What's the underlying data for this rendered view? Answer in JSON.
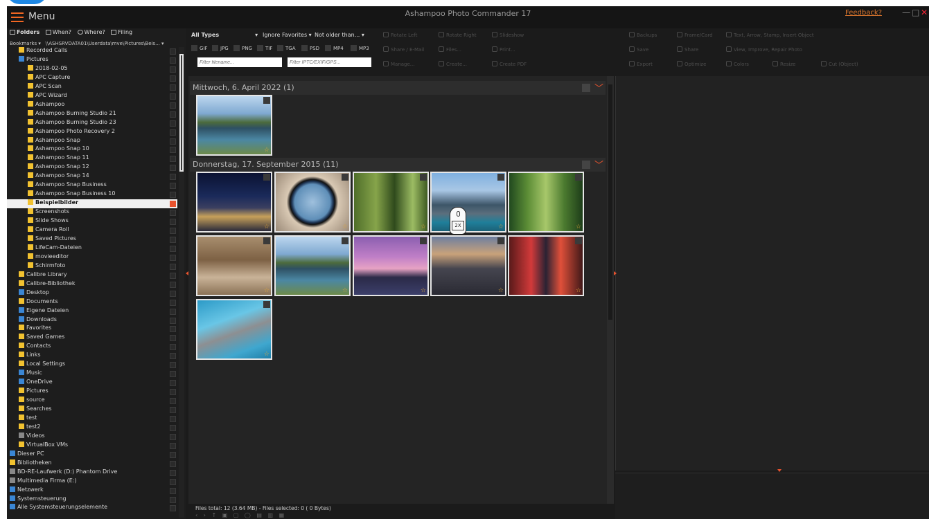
{
  "window": {
    "menu_label": "Menu",
    "title": "Ashampoo Photo Commander 17",
    "feedback_link": "Feedback?",
    "minimize": "—",
    "maximize": "□",
    "close": "✕"
  },
  "view_tabs": [
    {
      "label": "Folders"
    },
    {
      "label": "When?"
    },
    {
      "label": "Where?"
    },
    {
      "label": "Filing"
    }
  ],
  "bookmarks": {
    "label": "Bookmarks",
    "path": "\\\\ASHSRVDATA01\\Userdata\\mve\\Pictures\\Beis..."
  },
  "folder_tree": [
    {
      "label": "Recorded Calls",
      "indent": 2,
      "color": "yellow"
    },
    {
      "label": "Pictures",
      "indent": 2,
      "color": "blue"
    },
    {
      "label": "2018-02-05",
      "indent": 3,
      "color": "yellow"
    },
    {
      "label": "APC Capture",
      "indent": 3,
      "color": "yellow"
    },
    {
      "label": "APC Scan",
      "indent": 3,
      "color": "yellow"
    },
    {
      "label": "APC Wizard",
      "indent": 3,
      "color": "yellow"
    },
    {
      "label": "Ashampoo",
      "indent": 3,
      "color": "yellow"
    },
    {
      "label": "Ashampoo Burning Studio 21",
      "indent": 3,
      "color": "yellow"
    },
    {
      "label": "Ashampoo Burning Studio 23",
      "indent": 3,
      "color": "yellow"
    },
    {
      "label": "Ashampoo Photo Recovery 2",
      "indent": 3,
      "color": "yellow"
    },
    {
      "label": "Ashampoo Snap",
      "indent": 3,
      "color": "yellow"
    },
    {
      "label": "Ashampoo Snap 10",
      "indent": 3,
      "color": "yellow"
    },
    {
      "label": "Ashampoo Snap 11",
      "indent": 3,
      "color": "yellow"
    },
    {
      "label": "Ashampoo Snap 12",
      "indent": 3,
      "color": "yellow"
    },
    {
      "label": "Ashampoo Snap 14",
      "indent": 3,
      "color": "yellow"
    },
    {
      "label": "Ashampoo Snap Business",
      "indent": 3,
      "color": "yellow"
    },
    {
      "label": "Ashampoo Snap Business 10",
      "indent": 3,
      "color": "yellow"
    },
    {
      "label": "Beispielbilder",
      "indent": 3,
      "color": "yellow",
      "selected": true
    },
    {
      "label": "Screenshots",
      "indent": 3,
      "color": "yellow"
    },
    {
      "label": "Slide Shows",
      "indent": 3,
      "color": "yellow"
    },
    {
      "label": "Camera Roll",
      "indent": 3,
      "color": "yellow"
    },
    {
      "label": "Saved Pictures",
      "indent": 3,
      "color": "yellow"
    },
    {
      "label": "LifeCam-Dateien",
      "indent": 3,
      "color": "yellow"
    },
    {
      "label": "movieeditor",
      "indent": 3,
      "color": "yellow"
    },
    {
      "label": "Schirmfoto",
      "indent": 3,
      "color": "yellow"
    },
    {
      "label": "Calibre Library",
      "indent": 2,
      "color": "yellow"
    },
    {
      "label": "Calibre-Bibliothek",
      "indent": 2,
      "color": "yellow"
    },
    {
      "label": "Desktop",
      "indent": 2,
      "color": "blue"
    },
    {
      "label": "Documents",
      "indent": 2,
      "color": "yellow"
    },
    {
      "label": "Eigene Dateien",
      "indent": 2,
      "color": "blue"
    },
    {
      "label": "Downloads",
      "indent": 2,
      "color": "blue"
    },
    {
      "label": "Favorites",
      "indent": 2,
      "color": "yellow"
    },
    {
      "label": "Saved Games",
      "indent": 2,
      "color": "yellow"
    },
    {
      "label": "Contacts",
      "indent": 2,
      "color": "yellow"
    },
    {
      "label": "Links",
      "indent": 2,
      "color": "yellow"
    },
    {
      "label": "Local Settings",
      "indent": 2,
      "color": "yellow"
    },
    {
      "label": "Music",
      "indent": 2,
      "color": "blue"
    },
    {
      "label": "OneDrive",
      "indent": 2,
      "color": "blue"
    },
    {
      "label": "Pictures",
      "indent": 2,
      "color": "yellow"
    },
    {
      "label": "source",
      "indent": 2,
      "color": "yellow"
    },
    {
      "label": "Searches",
      "indent": 2,
      "color": "yellow"
    },
    {
      "label": "test",
      "indent": 2,
      "color": "yellow"
    },
    {
      "label": "test2",
      "indent": 2,
      "color": "yellow"
    },
    {
      "label": "Videos",
      "indent": 2,
      "color": "gray"
    },
    {
      "label": "VirtualBox VMs",
      "indent": 2,
      "color": "yellow"
    },
    {
      "label": "Dieser PC",
      "indent": 1,
      "color": "blue"
    },
    {
      "label": "Bibliotheken",
      "indent": 1,
      "color": "yellow"
    },
    {
      "label": "BD-RE-Laufwerk (D:) Phantom Drive",
      "indent": 1,
      "color": "gray"
    },
    {
      "label": "Multimedia Firma (E:)",
      "indent": 1,
      "color": "gray"
    },
    {
      "label": "Netzwerk",
      "indent": 1,
      "color": "blue"
    },
    {
      "label": "Systemsteuerung",
      "indent": 1,
      "color": "blue"
    },
    {
      "label": "Alle Systemsteuerungselemente",
      "indent": 1,
      "color": "blue"
    }
  ],
  "filters": {
    "type": "All Types",
    "favorites": "Ignore Favorites",
    "age": "Not older than...",
    "file_types": [
      "GIF",
      "JPG",
      "PNG",
      "TIF",
      "TGA",
      "PSD",
      "MP4",
      "MP3"
    ],
    "filename_placeholder": "Filter filename...",
    "exif_placeholder": "Filter IPTC/EXIF/GPS..."
  },
  "toolbar": [
    [
      "Rotate Left",
      "Rotate Right",
      "Slideshow",
      "Backups",
      "Frame/Card",
      "Text, Arrow, Stamp, Insert Object"
    ],
    [
      "Share / E-Mail",
      "Files...",
      "Print...",
      "Save",
      "Share",
      "View, Improve, Repair Photo"
    ],
    [
      "Manage...",
      "Create...",
      "Create PDF",
      "Export",
      "Optimize",
      "Colors",
      "Resize",
      "Cut (Object)"
    ]
  ],
  "groups": [
    {
      "title": "Mittwoch, 6. April 2022 (1)",
      "count": 1
    },
    {
      "title": "Donnerstag, 17. September 2015 (11)",
      "count": 11
    }
  ],
  "cursor_label": "2X",
  "status": {
    "text": "Files total: 12 (3.64 MB) - Files selected: 0 (  0 Bytes)"
  },
  "colors": {
    "accent": "#e8532e",
    "background": "#1b1b1b",
    "panel": "#242424",
    "selection": "#f0f0f0"
  }
}
